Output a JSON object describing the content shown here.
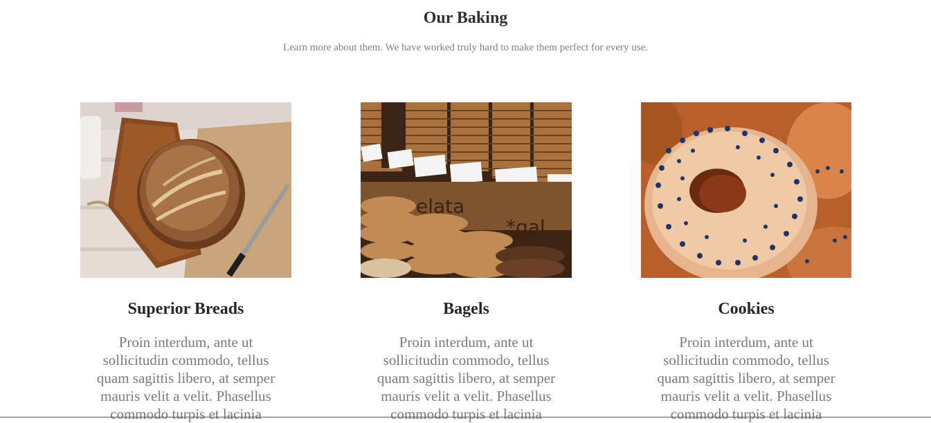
{
  "section": {
    "title": "Our Baking",
    "subtitle": "Learn more about them. We have worked truly hard to make them perfect for every use."
  },
  "cards": [
    {
      "title": "Superior Breads",
      "text": "Proin interdum, ante ut sollicitudin commodo, tellus quam sagittis libero, at semper mauris velit a velit. Phasellus commodo turpis et lacinia",
      "image": "bread-loaf-image"
    },
    {
      "title": "Bagels",
      "text": "Proin interdum, ante ut sollicitudin commodo, tellus quam sagittis libero, at semper mauris velit a velit. Phasellus commodo turpis et lacinia",
      "image": "cookie-stacks-image"
    },
    {
      "title": "Cookies",
      "text": "Proin interdum, ante ut sollicitudin commodo, tellus quam sagittis libero, at semper mauris velit a velit. Phasellus commodo turpis et lacinia",
      "image": "sprinkled-bagel-image"
    }
  ]
}
